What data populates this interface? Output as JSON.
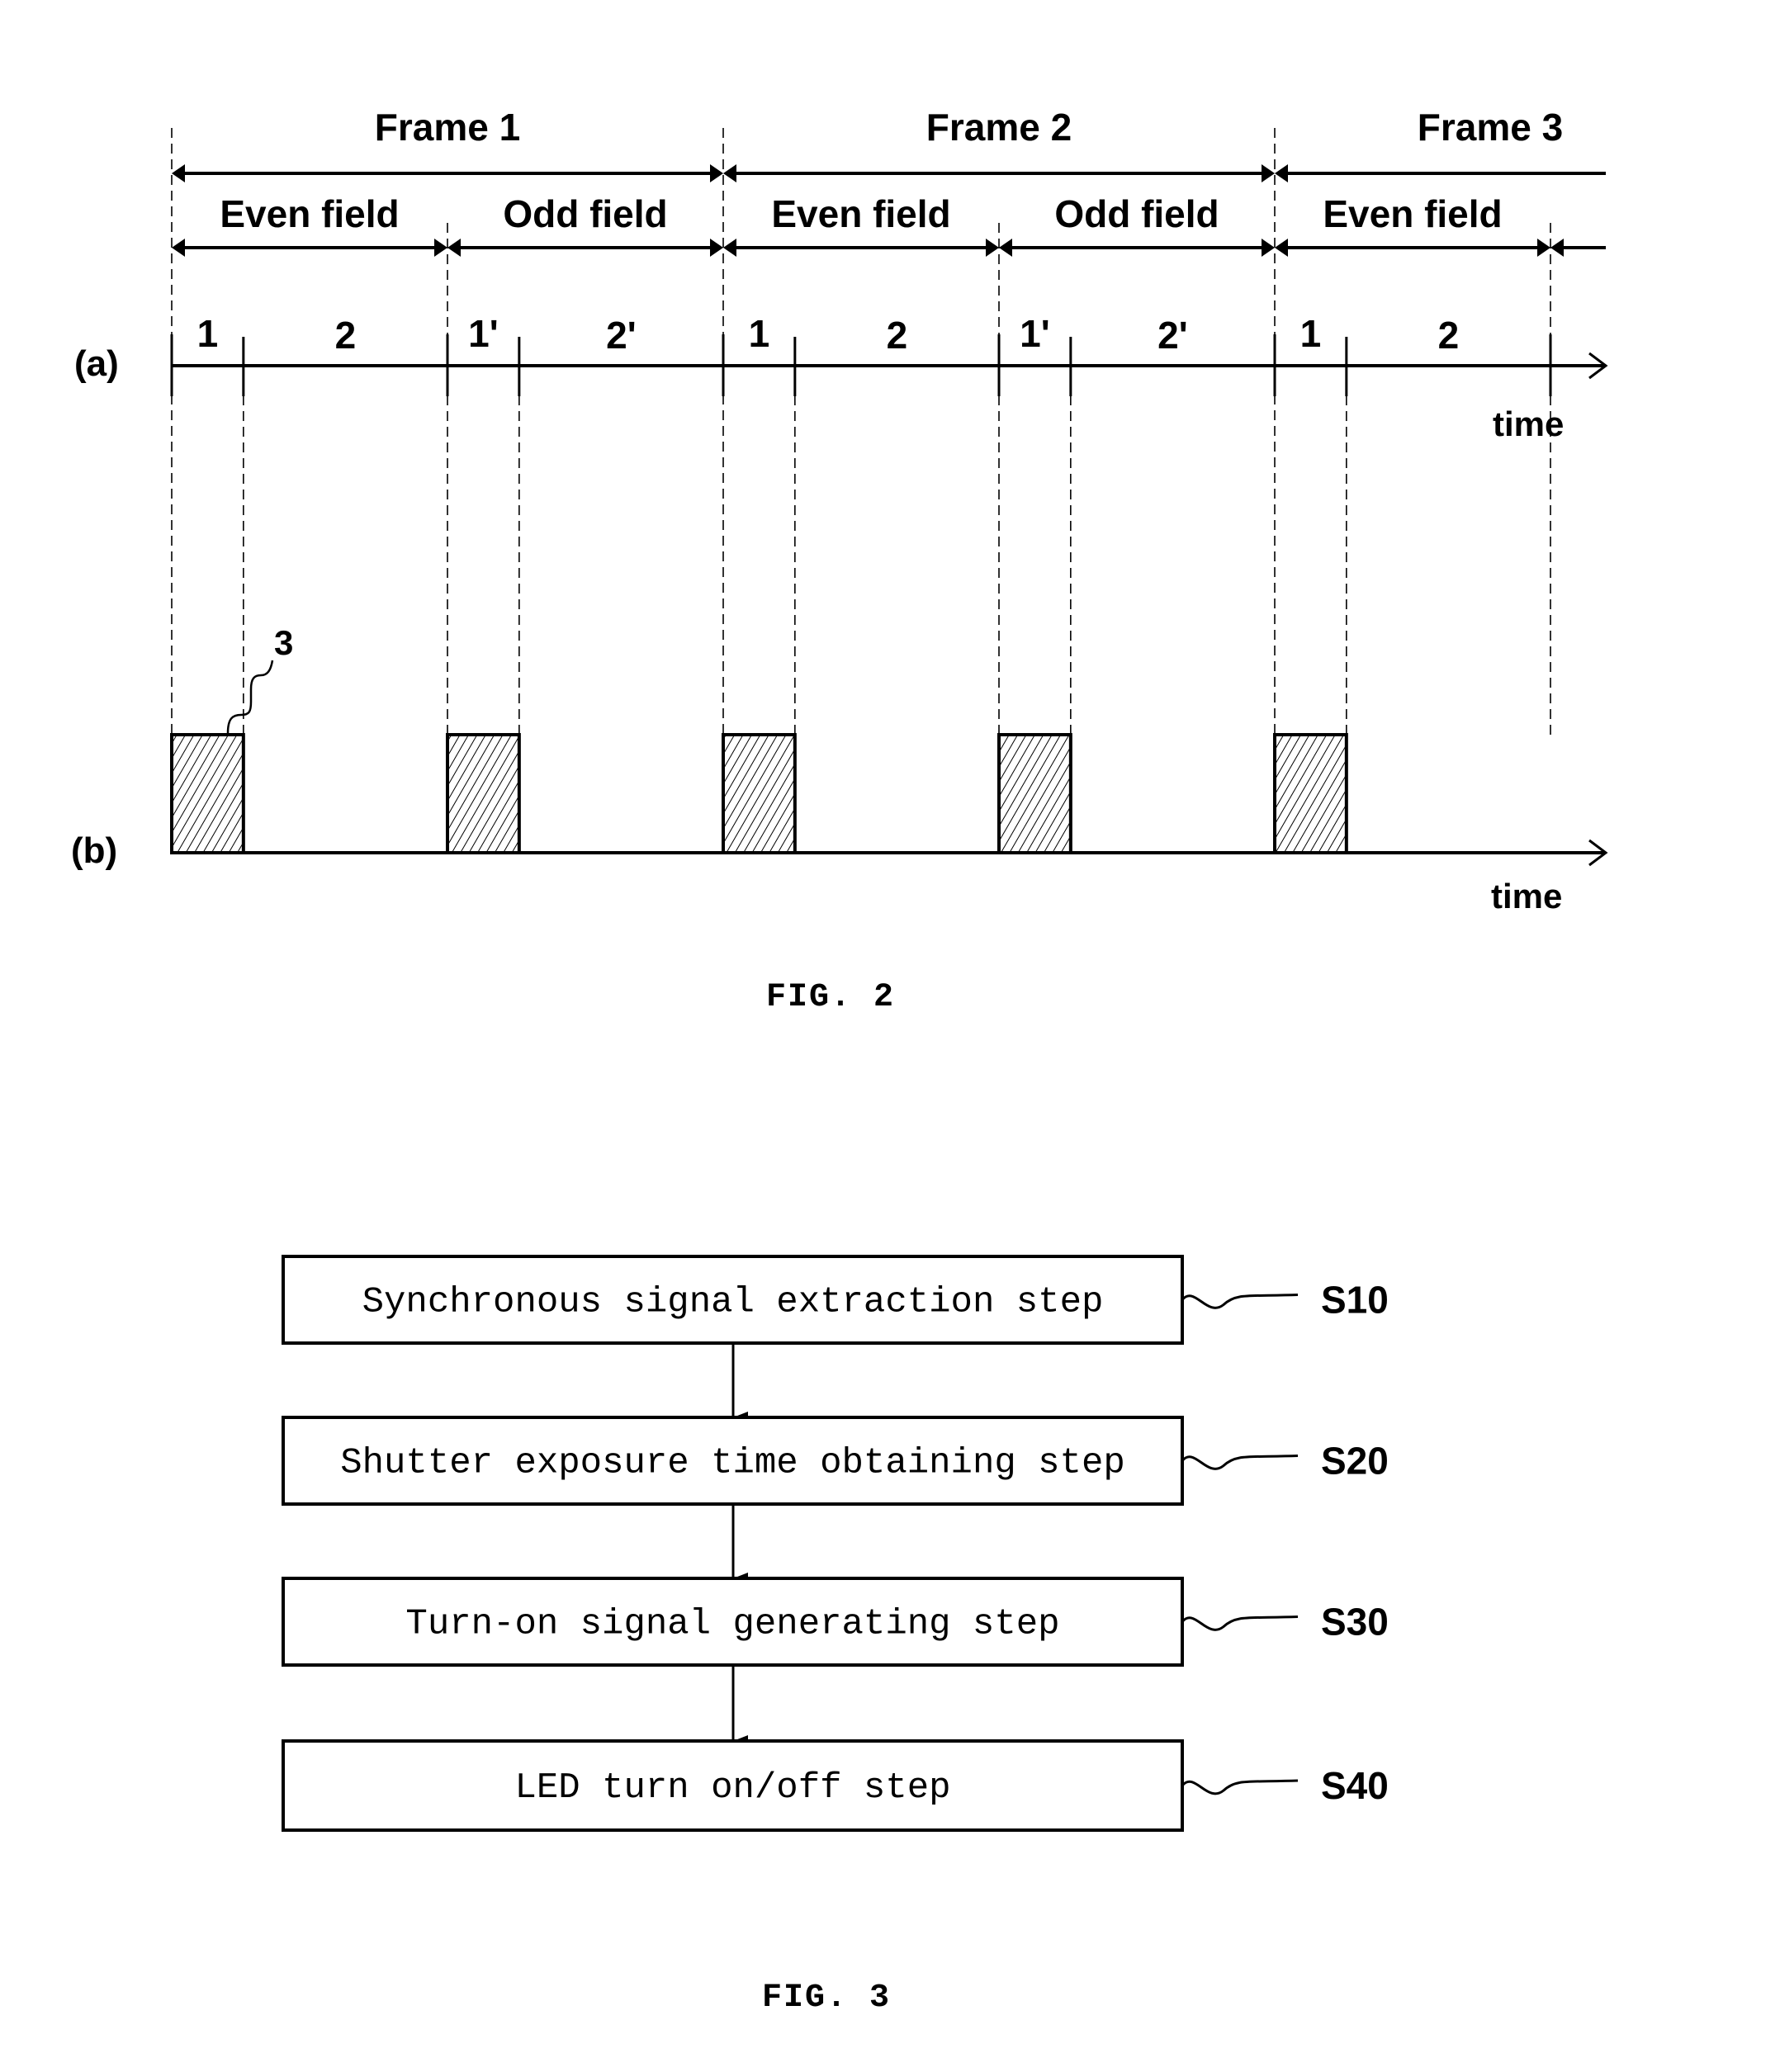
{
  "fig2": {
    "caption": "FIG. 2",
    "frames": [
      {
        "label": "Frame 1",
        "start": 0,
        "end": 2
      },
      {
        "label": "Frame 2",
        "start": 2,
        "end": 4
      },
      {
        "label": "Frame 3",
        "start": 4,
        "end": 6
      }
    ],
    "fields": [
      {
        "label": "Even field",
        "start": 0,
        "end": 1
      },
      {
        "label": "Odd field",
        "start": 1,
        "end": 2
      },
      {
        "label": "Even field",
        "start": 2,
        "end": 3
      },
      {
        "label": "Odd field",
        "start": 3,
        "end": 4
      },
      {
        "label": "Even field",
        "start": 4,
        "end": 5
      }
    ],
    "subperiod_split_fraction": 0.26,
    "row_a": {
      "label": "(a)",
      "axis_label": "time",
      "segments": [
        {
          "first": "1",
          "second": "2"
        },
        {
          "first": "1'",
          "second": "2'"
        },
        {
          "first": "1",
          "second": "2"
        },
        {
          "first": "1'",
          "second": "2'"
        },
        {
          "first": "1",
          "second": "2"
        }
      ]
    },
    "row_b": {
      "label": "(b)",
      "axis_label": "time",
      "pulse_count": 5,
      "pulse_reference": "3"
    }
  },
  "fig3": {
    "caption": "FIG. 3",
    "steps": [
      {
        "text": "Synchronous signal extraction step",
        "id": "S10"
      },
      {
        "text": "Shutter exposure time obtaining step",
        "id": "S20"
      },
      {
        "text": "Turn-on signal generating step",
        "id": "S30"
      },
      {
        "text": "LED turn on/off step",
        "id": "S40"
      }
    ]
  },
  "colors": {
    "ink": "#000000",
    "paper": "#ffffff"
  }
}
